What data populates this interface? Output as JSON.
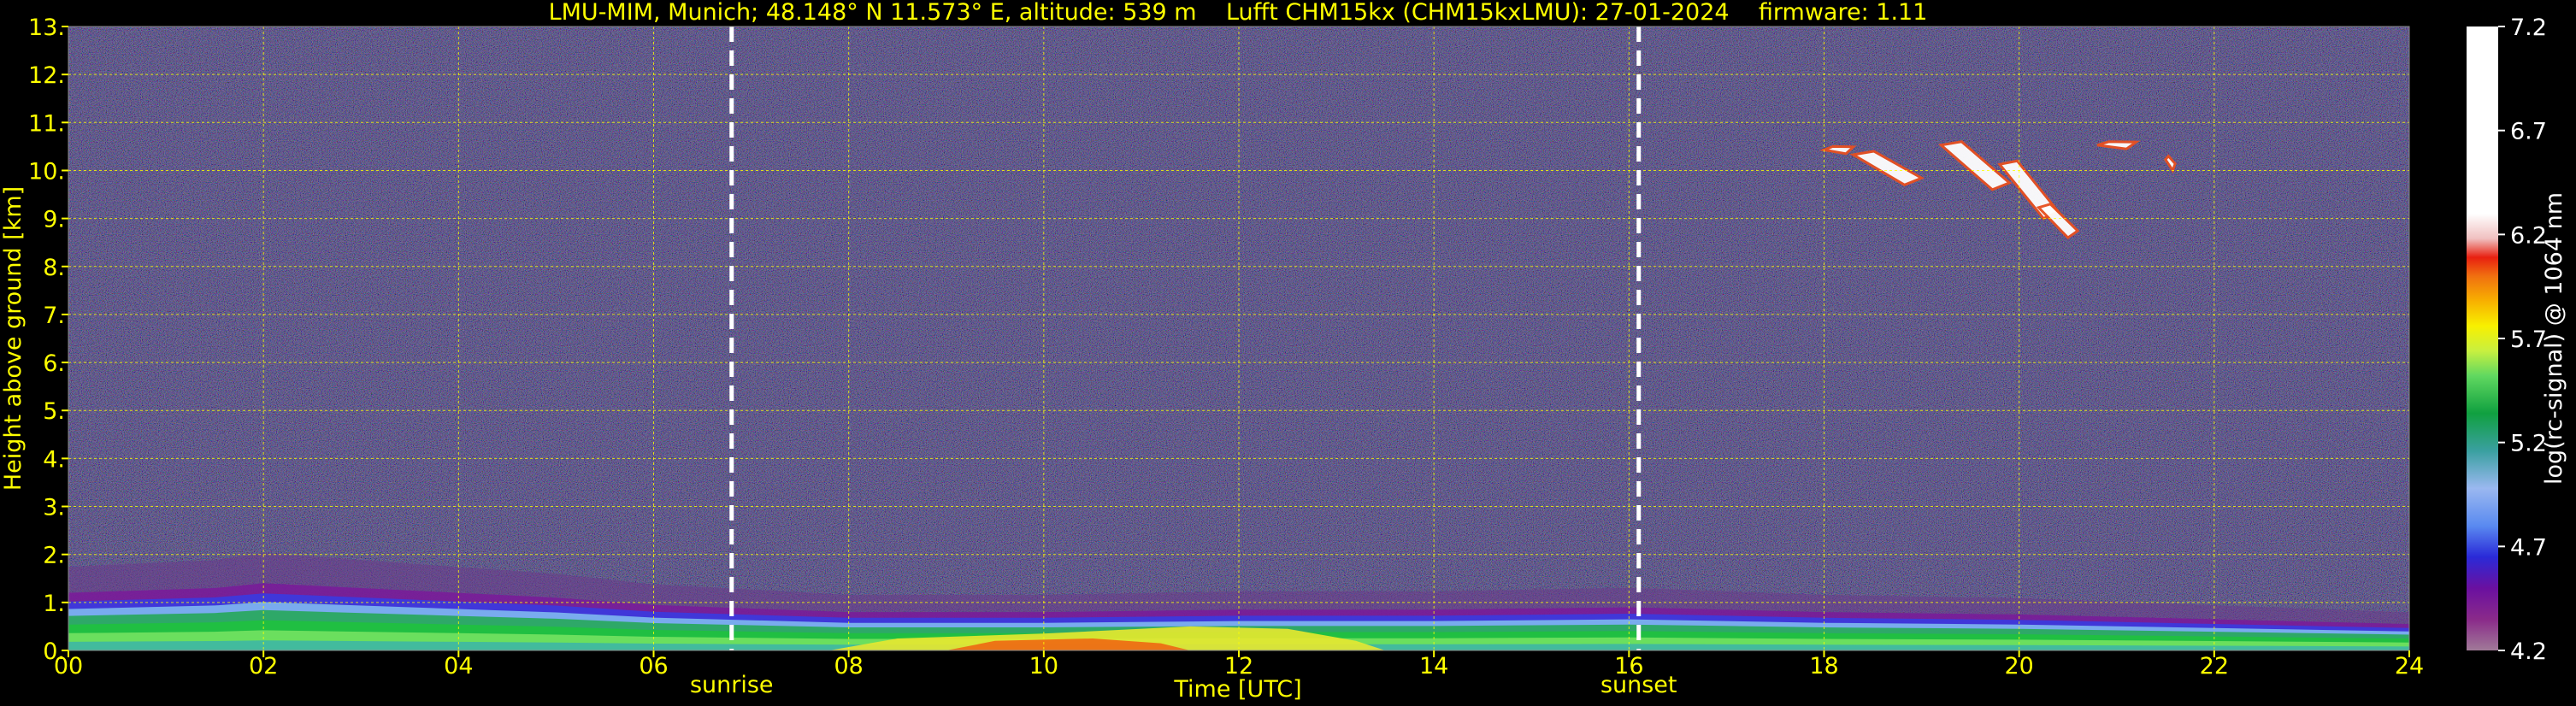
{
  "chart_data": {
    "type": "heatmap",
    "title": "LMU-MIM, Munich; 48.148° N 11.573° E, altitude: 539 m    Lufft CHM15kx (CHM15kxLMU): 27-01-2024    firmware: 1.11",
    "xlabel": "Time [UTC]",
    "ylabel": "Height above ground [km]",
    "xlim": [
      0,
      24
    ],
    "ylim": [
      0,
      13
    ],
    "x_ticks": [
      "00",
      "02",
      "04",
      "06",
      "08",
      "10",
      "12",
      "14",
      "16",
      "18",
      "20",
      "22",
      "24"
    ],
    "x_tick_values": [
      0,
      2,
      4,
      6,
      8,
      10,
      12,
      14,
      16,
      18,
      20,
      22,
      24
    ],
    "y_ticks": [
      "0.",
      "1.",
      "2.",
      "3.",
      "4.",
      "5.",
      "6.",
      "7.",
      "8.",
      "9.",
      "10.",
      "11.",
      "12.",
      "13."
    ],
    "y_tick_values": [
      0,
      1,
      2,
      3,
      4,
      5,
      6,
      7,
      8,
      9,
      10,
      11,
      12,
      13
    ],
    "grid": true,
    "markers": [
      {
        "label": "sunrise",
        "x": 6.8
      },
      {
        "label": "sunset",
        "x": 16.1
      }
    ],
    "colorbar": {
      "label": "log(rc-signal) @ 1064 nm",
      "range": [
        4.2,
        7.2
      ],
      "ticks": [
        "7.2",
        "6.7",
        "6.2",
        "5.7",
        "5.2",
        "4.7",
        "4.2"
      ],
      "tick_values": [
        7.2,
        6.7,
        6.2,
        5.7,
        5.2,
        4.7,
        4.2
      ]
    },
    "features": {
      "boundary_layer_top_km": [
        {
          "t": 0,
          "h": 1.2
        },
        {
          "t": 1.5,
          "h": 1.3
        },
        {
          "t": 2,
          "h": 1.4
        },
        {
          "t": 4,
          "h": 1.2
        },
        {
          "t": 5,
          "h": 1.1
        },
        {
          "t": 6,
          "h": 0.95
        },
        {
          "t": 8,
          "h": 0.8
        },
        {
          "t": 10,
          "h": 0.8
        },
        {
          "t": 12,
          "h": 0.85
        },
        {
          "t": 14,
          "h": 0.85
        },
        {
          "t": 16,
          "h": 0.9
        },
        {
          "t": 18,
          "h": 0.8
        },
        {
          "t": 20,
          "h": 0.75
        },
        {
          "t": 22,
          "h": 0.65
        },
        {
          "t": 24,
          "h": 0.55
        }
      ],
      "cirrus_cloud": {
        "t_start": 18.0,
        "t_end": 21.6,
        "h_bottom": 8.6,
        "h_top": 10.6
      }
    }
  },
  "colors": {
    "axis_text": "#ffff00",
    "grid": "#ffff00",
    "background": "#000000",
    "marker_line": "#ffffff"
  }
}
